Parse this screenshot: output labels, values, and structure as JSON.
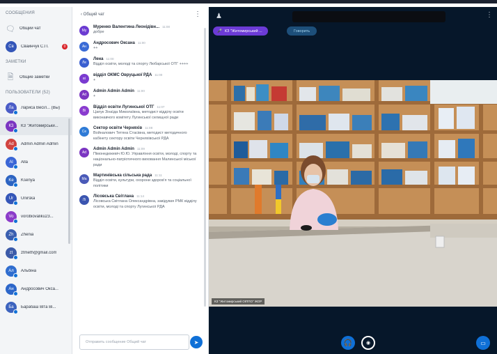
{
  "left_panel": {
    "messages_title": "СООБЩЕНИЯ",
    "public_chat_label": "Общий чат",
    "direct_chat": {
      "initials": "Св",
      "name": "Сваинчук С.П.",
      "unread": "0"
    },
    "notes_title": "ЗАМЕТКИ",
    "shared_notes_label": "Общие заметки",
    "users_title": "ПОЛЬЗОВАТЕЛИ (52)",
    "users": [
      {
        "initials": "Ла",
        "name": "Лариса Весіл... (Вы)",
        "color": "#4a5cc7"
      },
      {
        "initials": "КЗ",
        "name": "КЗ \"Житомирськи...",
        "color": "#7b35c1"
      },
      {
        "initials": "Ad",
        "name": "Admin Admin Admin",
        "color": "#d1433f"
      },
      {
        "initials": "Al",
        "name": "Alla",
        "color": "#3a66d6"
      },
      {
        "initials": "Ke",
        "name": "Ksenya",
        "color": "#2c64c2"
      },
      {
        "initials": "Ur",
        "name": "Unirska",
        "color": "#3456b8"
      },
      {
        "initials": "Vo",
        "name": "vorobiovaliku23...",
        "color": "#8b3cc9"
      },
      {
        "initials": "Zh",
        "name": "Zhenia",
        "color": "#3a5fb0"
      },
      {
        "initials": "zt",
        "name": "ztmeth@gmail.com",
        "color": "#3b5aa8"
      },
      {
        "initials": "Ал",
        "name": "Альбіна",
        "color": "#2f6dcf"
      },
      {
        "initials": "Ан",
        "name": "Андросович Окса...",
        "color": "#2c66c9"
      },
      {
        "initials": "Ба",
        "name": "Барабаш Віта Ві...",
        "color": "#3c63be"
      }
    ]
  },
  "chat": {
    "back_label": "‹  Общий чат",
    "input_placeholder": "Отправить сообщение Общий чат",
    "messages": [
      {
        "initials": "Му",
        "color": "#6b3bd1",
        "name": "Муренко Валентина Леонідівн...",
        "time": "11:00",
        "text": "добре"
      },
      {
        "initials": "Ан",
        "color": "#3a6bd6",
        "name": "Андросович Оксана",
        "time": "11:00",
        "text": "++"
      },
      {
        "initials": "Ле",
        "color": "#3a5fd0",
        "name": "Лена",
        "time": "11:00",
        "text": "Відділ освіти, молоді та спорту Любарської ОТГ ++++"
      },
      {
        "initials": "ві",
        "color": "#7a3bd0",
        "name": "відділ ОКМС Овруцької РДА",
        "time": "11:00",
        "text": "+"
      },
      {
        "initials": "Ad",
        "color": "#7b35c1",
        "name": "Admin Admin Admin",
        "time": "11:00",
        "text": "+"
      },
      {
        "initials": "Ві",
        "color": "#8a3ccf",
        "name": "Відділ освіти Лугинської ОТГ",
        "time": "11:07",
        "text": "Цапук Зінаїда Миколаївна, методист відділу освіти виконавчого комітету Лугинської селищної ради"
      },
      {
        "initials": "Се",
        "color": "#2f7bd6",
        "name": "Сектор освіти Черняхів",
        "time": "11:08",
        "text": "Войналович Тетяна Стасівна, методист методичного кабінету сектору освіти Черняхівської РДА"
      },
      {
        "initials": "Ad",
        "color": "#7b35c1",
        "name": "Admin Admin Admin",
        "time": "11:09",
        "text": "Пімонедюкевіч Ю.Ю. Управління освіти, молоді, спорту та національно-патріотичного виховання Малинської міської ради"
      },
      {
        "initials": "Ма",
        "color": "#4a5ab8",
        "name": "Мартинівська сільська рада",
        "time": "11:11",
        "text": "Відділ освіти, культури, охорони здоров'я та соціальної політики"
      },
      {
        "initials": "Лі",
        "color": "#3b55b0",
        "name": "Лісовська Світлана",
        "time": "11:14",
        "text": "Лісовська Світлана Олександрівна, завідувач РМК відділу освіти, молоді та спорту Лугинської РДА"
      }
    ]
  },
  "stage": {
    "presenter_pill": "КЗ \"Житомирський ...",
    "status_pill": "Говорить",
    "video_caption": "КЗ \"Житомирський ОІППО\" ЖОР"
  },
  "colors": {
    "accent": "#0f70d7",
    "stage_bg": "#06172a",
    "presenter_pill": "#6c3bd6"
  }
}
